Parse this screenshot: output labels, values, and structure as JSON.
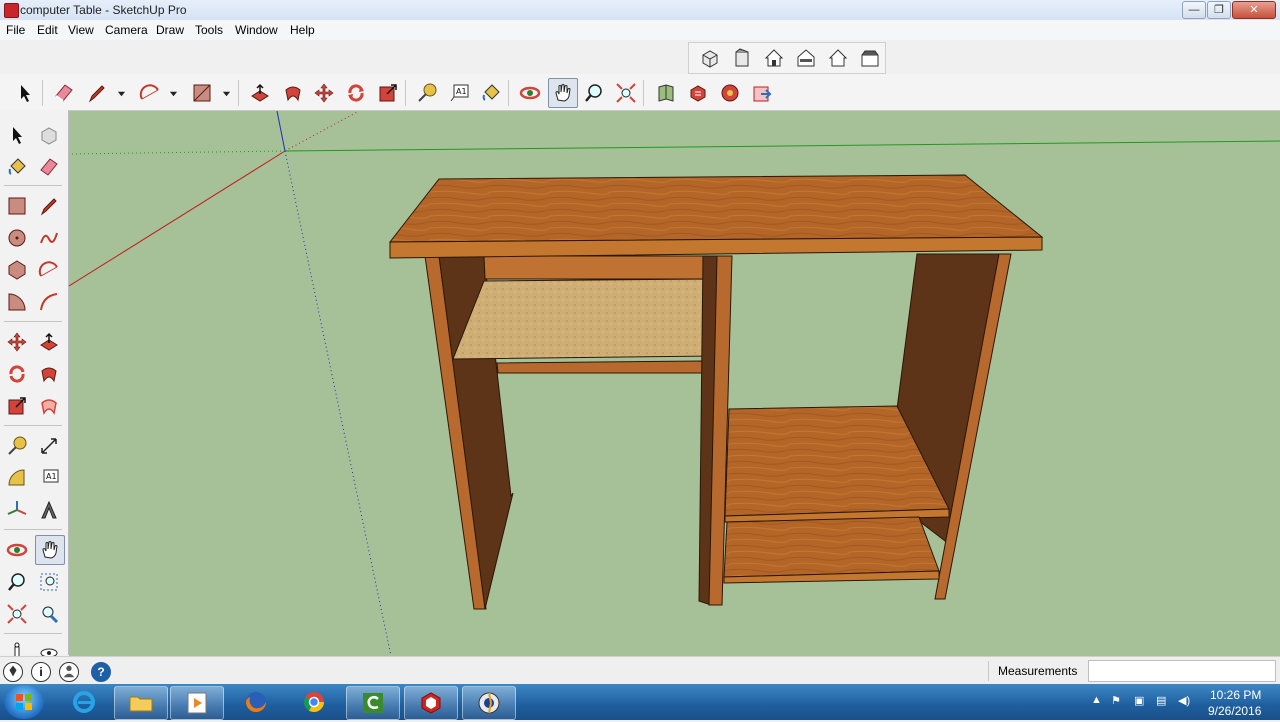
{
  "window": {
    "title": "computer Table - SketchUp Pro",
    "min": "—",
    "max": "❐",
    "close": "✕"
  },
  "menu": [
    "File",
    "Edit",
    "View",
    "Camera",
    "Draw",
    "Tools",
    "Window",
    "Help"
  ],
  "status": {
    "measurements_label": "Measurements",
    "measurements_value": "",
    "help_icon": "?",
    "info_icon": "i"
  },
  "taskbar": {
    "apps": [
      "internet-explorer",
      "file-explorer",
      "media-player",
      "firefox",
      "chrome",
      "camtasia",
      "sketchup",
      "screen-recorder"
    ],
    "time": "10:26 PM",
    "date": "9/26/2016"
  },
  "colors": {
    "viewport_bg": "#a6c197",
    "wood_top": "#b5672c",
    "wood_dark": "#5e3517",
    "shelf_light": "#d2b27a"
  }
}
